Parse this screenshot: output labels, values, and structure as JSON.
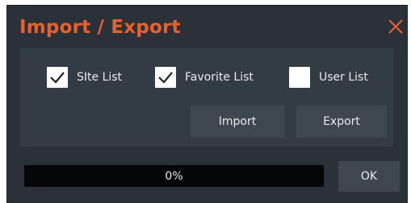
{
  "dialog": {
    "title": "Import / Export",
    "close_icon": "close-icon",
    "accent_color": "#e6612c",
    "background": "#2b3138",
    "panel_background": "#333b44",
    "button_background": "#3e4650"
  },
  "options": [
    {
      "label": "SIte List",
      "checked": true
    },
    {
      "label": "Favorite List",
      "checked": true
    },
    {
      "label": "User List",
      "checked": false
    }
  ],
  "buttons": {
    "import": "Import",
    "export": "Export",
    "ok": "OK"
  },
  "progress": {
    "text": "0%",
    "value": 0
  }
}
